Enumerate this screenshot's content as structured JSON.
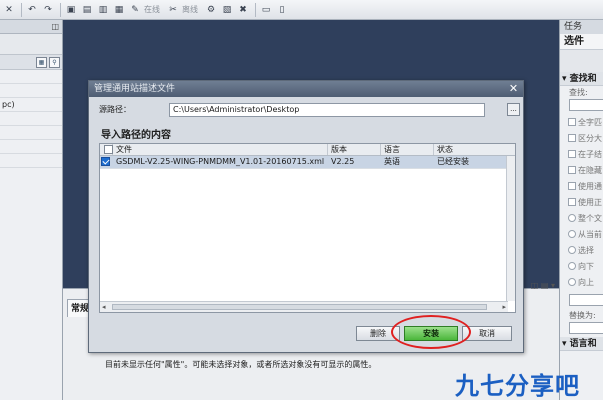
{
  "toolbar": {
    "online_label": "在线",
    "offline_label": "离线"
  },
  "task_panel": {
    "title": "任务",
    "subtitle": "选件",
    "section": "查找和",
    "find_label": "查找:",
    "checks": [
      "全字匹",
      "区分大",
      "在子结",
      "在隐藏",
      "使用通",
      "使用正"
    ],
    "radios": [
      "整个文",
      "从当前",
      "选择"
    ],
    "direction": [
      "向下",
      "向上"
    ],
    "replace_label": "替换为:",
    "section2": "语言和"
  },
  "inspector": {
    "tab_label": "常规",
    "message": "目前未显示任何\"属性\"。可能未选择对象，或者所选对象没有可显示的属性。"
  },
  "dialog": {
    "title": "管理通用站描述文件",
    "source_label": "源路径：",
    "source_path": "C:\\Users\\Administrator\\Desktop",
    "browse_label": "...",
    "content_header": "导入路径的内容",
    "columns": [
      "文件",
      "版本",
      "语言",
      "状态"
    ],
    "rows": [
      {
        "checked": true,
        "file": "GSDML-V2.25-WING-PNMDMM_V1.01-20160715.xml",
        "version": "V2.25",
        "language": "英语",
        "status": "已经安装"
      }
    ],
    "buttons": {
      "delete": "删除",
      "install": "安装",
      "cancel": "取消"
    }
  },
  "watermark": "九七分享吧"
}
